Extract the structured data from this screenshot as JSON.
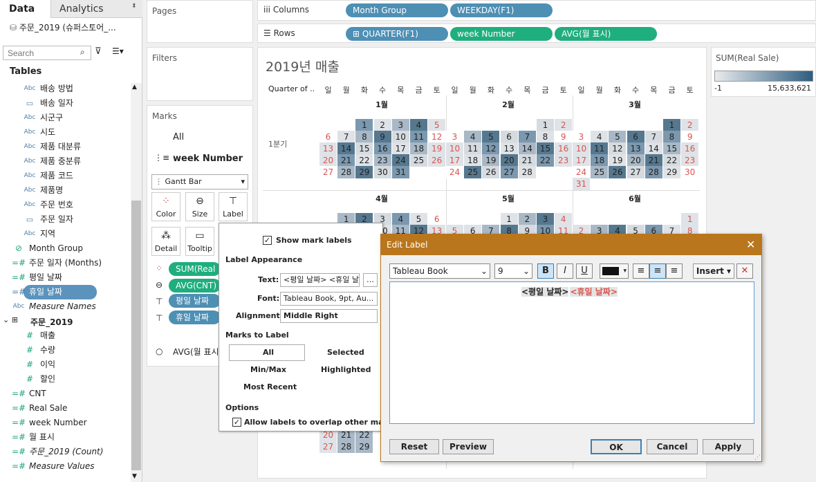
{
  "tabs": {
    "data": "Data",
    "analytics": "Analytics"
  },
  "datasource": "주문_2019 (슈퍼스토어_...",
  "search_placeholder": "Search",
  "tables_heading": "Tables",
  "fields": [
    {
      "type": "Abc",
      "name": "배송 방법"
    },
    {
      "type": "date",
      "name": "배송 일자"
    },
    {
      "type": "Abc",
      "name": "시군구"
    },
    {
      "type": "Abc",
      "name": "시도"
    },
    {
      "type": "Abc",
      "name": "제품 대분류"
    },
    {
      "type": "Abc",
      "name": "제품 중분류"
    },
    {
      "type": "Abc",
      "name": "제품 코드"
    },
    {
      "type": "Abc",
      "name": "제품명"
    },
    {
      "type": "Abc",
      "name": "주문 번호"
    },
    {
      "type": "date",
      "name": "주문 일자"
    },
    {
      "type": "Abc",
      "name": "지역"
    }
  ],
  "fields2": [
    {
      "type": "clip",
      "name": "Month Group"
    },
    {
      "type": "calc",
      "name": "주문 일자 (Months)"
    },
    {
      "type": "calc",
      "name": "평일 날짜"
    },
    {
      "type": "calc",
      "name": "휴일 날짜"
    },
    {
      "type": "Abc",
      "name": "Measure Names"
    }
  ],
  "table2": "주문_2019",
  "measures": [
    "매출",
    "수량",
    "이익",
    "할인"
  ],
  "measures2": [
    "CNT",
    "Real Sale",
    "week Number",
    "월 표시",
    "주문_2019 (Count)",
    "Measure Values"
  ],
  "shelves": {
    "pages": "Pages",
    "filters": "Filters",
    "marks": "Marks",
    "columns": "Columns",
    "rows": "Rows"
  },
  "marks": {
    "all": "All",
    "week": "week Number",
    "type": "Gantt Bar",
    "color": "Color",
    "size": "Size",
    "label": "Label",
    "detail": "Detail",
    "tooltip": "Tooltip",
    "pills": [
      "SUM(Real Sale)",
      "AVG(CNT)",
      "평일 날짜",
      "휴일 날짜"
    ],
    "avg_month": "AVG(월 표시)"
  },
  "columns": [
    "Month Group",
    "WEEKDAY(F1)"
  ],
  "rows": [
    "QUARTER(F1)",
    "week Number",
    "AVG(월 표시)"
  ],
  "view": {
    "title": "2019년 매출",
    "quarter_header": "Quarter of ..",
    "quarter1": "1분기",
    "days": [
      "일",
      "월",
      "화",
      "수",
      "목",
      "금",
      "토"
    ],
    "months": [
      "1월",
      "2월",
      "3월",
      "4월",
      "5월",
      "6월"
    ]
  },
  "legend": {
    "title": "SUM(Real Sale)",
    "min": "-1",
    "max": "15,633,621"
  },
  "label_popup": {
    "show": "Show mark labels",
    "appearance": "Label Appearance",
    "text_label": "Text:",
    "text_value": "<평일 날짜> <휴일 날짜>",
    "font_label": "Font:",
    "font_value": "Tableau Book, 9pt, Au...",
    "align_label": "Alignment:",
    "align_value": "Middle Right",
    "marks_to_label": "Marks to Label",
    "all": "All",
    "selected": "Selected",
    "minmax": "Min/Max",
    "highlighted": "Highlighted",
    "recent": "Most Recent",
    "options": "Options",
    "overlap": "Allow labels to overlap other marks"
  },
  "dialog": {
    "title": "Edit Label",
    "font": "Tableau Book",
    "size": "9",
    "bold": "B",
    "italic": "I",
    "underline": "U",
    "insert": "Insert",
    "text_a": "<평일 날짜>",
    "text_b": "<휴일 날짜>",
    "reset": "Reset",
    "preview": "Preview",
    "ok": "OK",
    "cancel": "Cancel",
    "apply": "Apply"
  },
  "colors": {
    "accent": "#1fae7d",
    "pill_blue": "#4e8fb4",
    "dialog": "#b9761c"
  }
}
